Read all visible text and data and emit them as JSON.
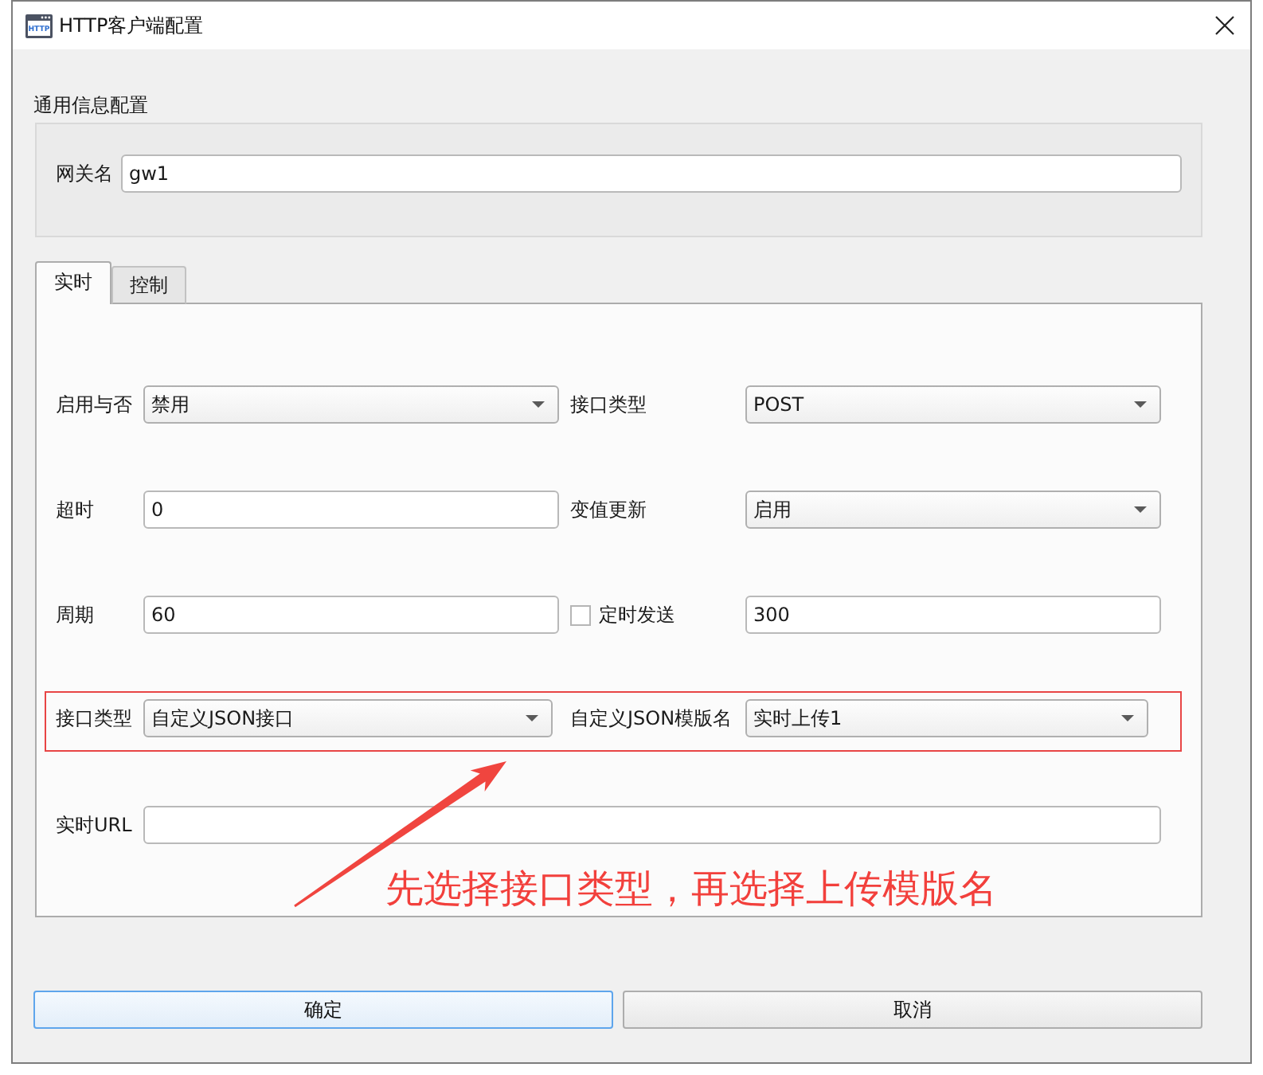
{
  "window": {
    "title": "HTTP客户端配置",
    "icon_label": "HTTP"
  },
  "general": {
    "heading": "通用信息配置",
    "fields": [
      {
        "label": "网关名",
        "value": "gw1"
      }
    ]
  },
  "tabs": [
    {
      "label": "实时",
      "selected": true
    },
    {
      "label": "控制",
      "selected": false
    }
  ],
  "rows": [
    {
      "highlighted": false,
      "fields": [
        {
          "kind": "combo",
          "label": "启用与否",
          "value": "禁用"
        },
        {
          "kind": "combo",
          "label": "接口类型",
          "value": "POST"
        }
      ]
    },
    {
      "highlighted": false,
      "fields": [
        {
          "kind": "input",
          "label": "超时",
          "value": "0"
        },
        {
          "kind": "combo",
          "label": "变值更新",
          "value": "启用"
        }
      ]
    },
    {
      "highlighted": false,
      "fields": [
        {
          "kind": "input",
          "label": "周期",
          "value": "60"
        },
        {
          "kind": "check_input",
          "label": "定时发送",
          "checked": false,
          "value": "300"
        }
      ]
    },
    {
      "highlighted": true,
      "fields": [
        {
          "kind": "combo",
          "label": "接口类型",
          "value": "自定义JSON接口"
        },
        {
          "kind": "combo",
          "label": "自定义JSON模版名",
          "value": "实时上传1"
        }
      ]
    },
    {
      "highlighted": false,
      "fields": [
        {
          "kind": "wide_input",
          "label": "实时URL"
        }
      ]
    }
  ],
  "annotation": {
    "text": "先选择接口类型，再选择上传模版名"
  },
  "buttons": [
    {
      "label": "确定",
      "focused": true
    },
    {
      "label": "取消",
      "focused": false
    }
  ]
}
